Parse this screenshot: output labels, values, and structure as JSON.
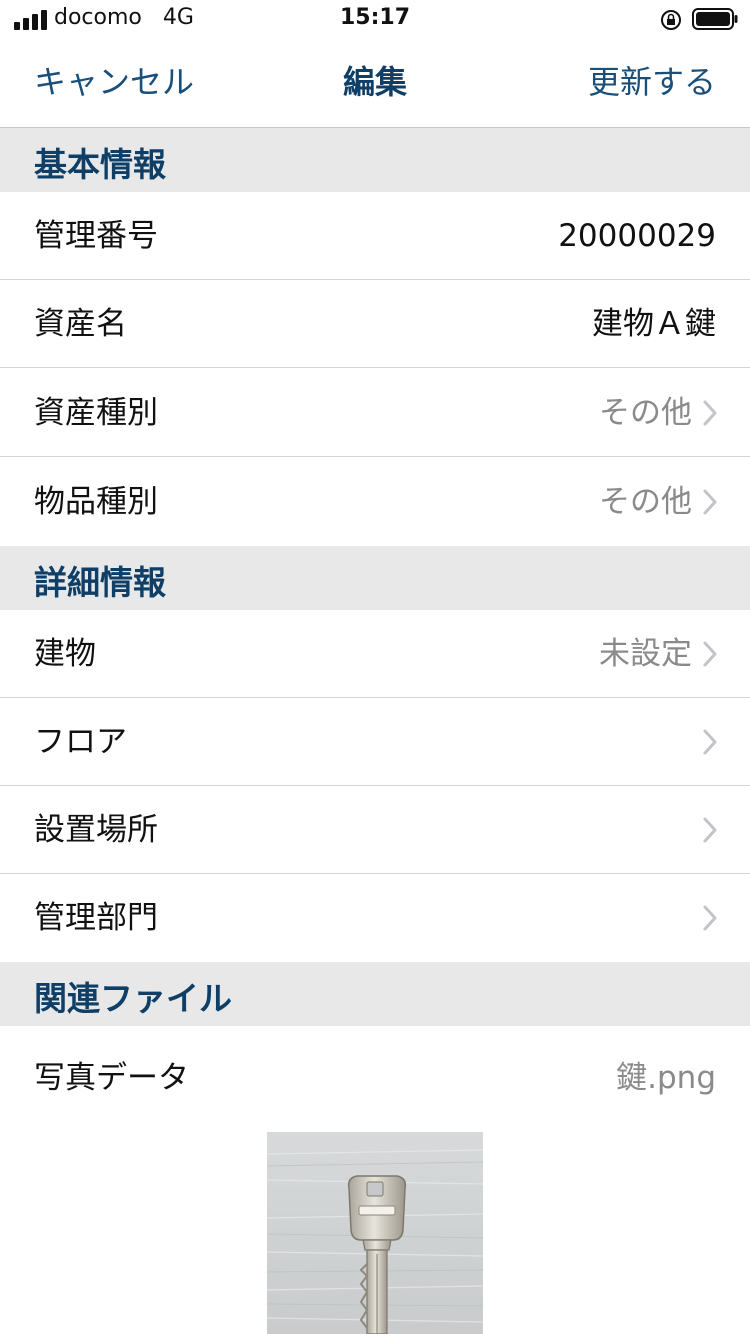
{
  "status_bar": {
    "carrier": "docomo",
    "network": "4G",
    "time": "15:17"
  },
  "nav": {
    "cancel": "キャンセル",
    "title": "編集",
    "update": "更新する"
  },
  "sections": {
    "basic": {
      "header": "基本情報",
      "rows": [
        {
          "label": "管理番号",
          "value": "20000029"
        },
        {
          "label": "資産名",
          "value": "建物Ａ鍵"
        },
        {
          "label": "資産種別",
          "value": "その他"
        },
        {
          "label": "物品種別",
          "value": "その他"
        }
      ]
    },
    "detail": {
      "header": "詳細情報",
      "rows": [
        {
          "label": "建物",
          "value": "未設定"
        },
        {
          "label": "フロア",
          "value": ""
        },
        {
          "label": "設置場所",
          "value": ""
        },
        {
          "label": "管理部門",
          "value": ""
        }
      ]
    },
    "files": {
      "header": "関連ファイル",
      "rows": [
        {
          "label": "写真データ",
          "value": "鍵.png"
        }
      ]
    }
  },
  "colors": {
    "accent": "#1a4f7a",
    "section_bg": "#e8e8e8",
    "secondary_text": "#8a8a8a"
  }
}
